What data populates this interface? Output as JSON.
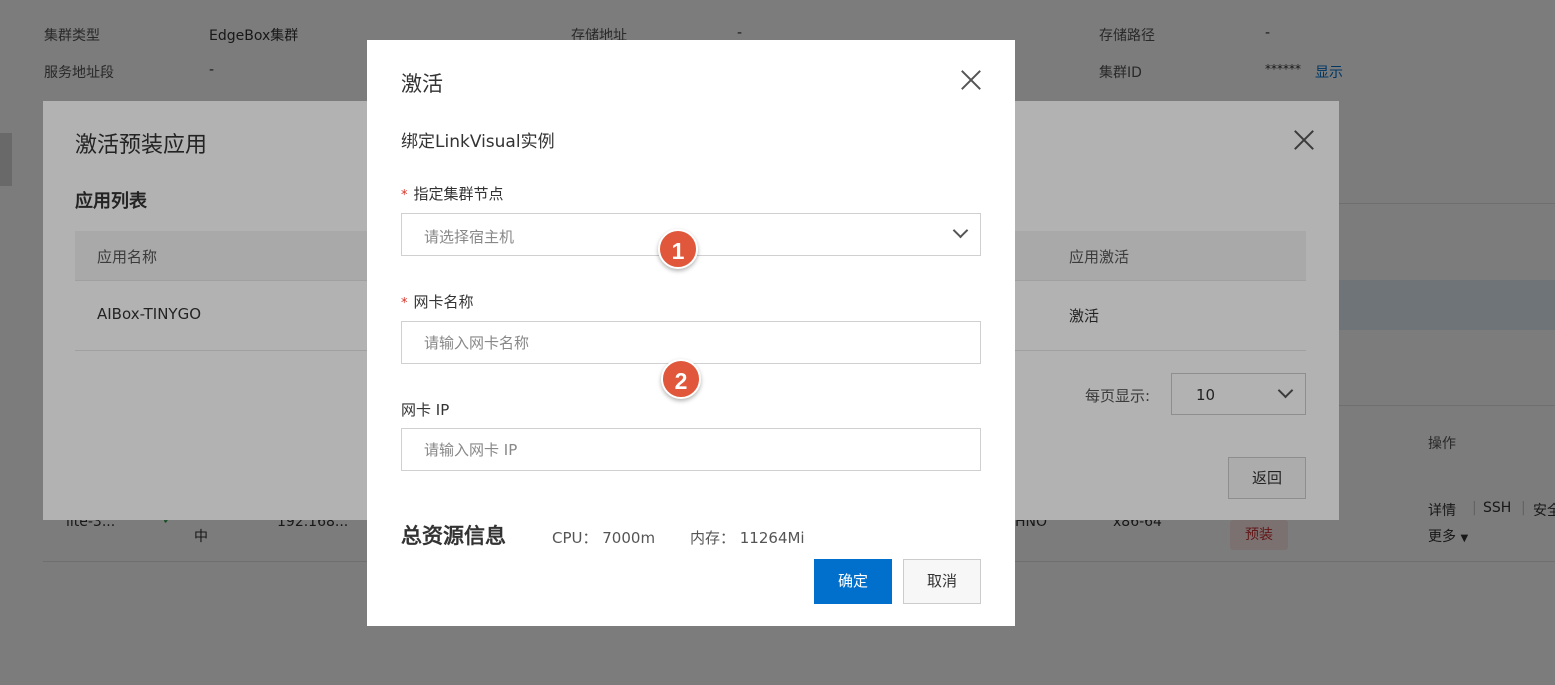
{
  "background": {
    "info": {
      "cluster_type_label": "集群类型",
      "cluster_type_value": "EdgeBox集群",
      "storage_addr_label": "存储地址",
      "storage_addr_value": "-",
      "storage_path_label": "存储路径",
      "storage_path_value": "-",
      "service_range_label": "服务地址段",
      "service_range_value": "-",
      "cluster_id_label": "集群ID",
      "cluster_id_value": "******",
      "show_link": "显示"
    },
    "table": {
      "ops_header": "操作",
      "row_name": "lite-3...",
      "row_status": "中",
      "row_ip": "192.168...",
      "row_model": "HNO",
      "row_arch": "x86-64",
      "row_badge": "预装",
      "op_detail": "详情",
      "op_ssh": "SSH",
      "op_security": "安全",
      "op_more": "更多"
    }
  },
  "dialog1": {
    "title": "激活预装应用",
    "section": "应用列表",
    "columns": {
      "app_name": "应用名称",
      "app_activate": "应用激活"
    },
    "rows": [
      {
        "name": "AIBox-TINYGO",
        "action": "激活"
      }
    ],
    "page_size_label": "每页显示:",
    "page_size_value": "10",
    "back_button": "返回"
  },
  "dialog2": {
    "title": "激活",
    "subtitle": "绑定LinkVisual实例",
    "required_mark": "*",
    "node_label": "指定集群节点",
    "node_placeholder": "请选择宿主机",
    "nic_name_label": "网卡名称",
    "nic_name_placeholder": "请输入网卡名称",
    "nic_ip_label": "网卡 IP",
    "nic_ip_placeholder": "请输入网卡 IP",
    "resource_title": "总资源信息",
    "cpu_text": "CPU： 7000m",
    "mem_text": "内存： 11264Mi",
    "ok_button": "确定",
    "cancel_button": "取消",
    "marker_1": "1",
    "marker_2": "2"
  },
  "colors": {
    "accent": "#0070cc",
    "marker": "#e0573b",
    "required": "#d93026"
  }
}
